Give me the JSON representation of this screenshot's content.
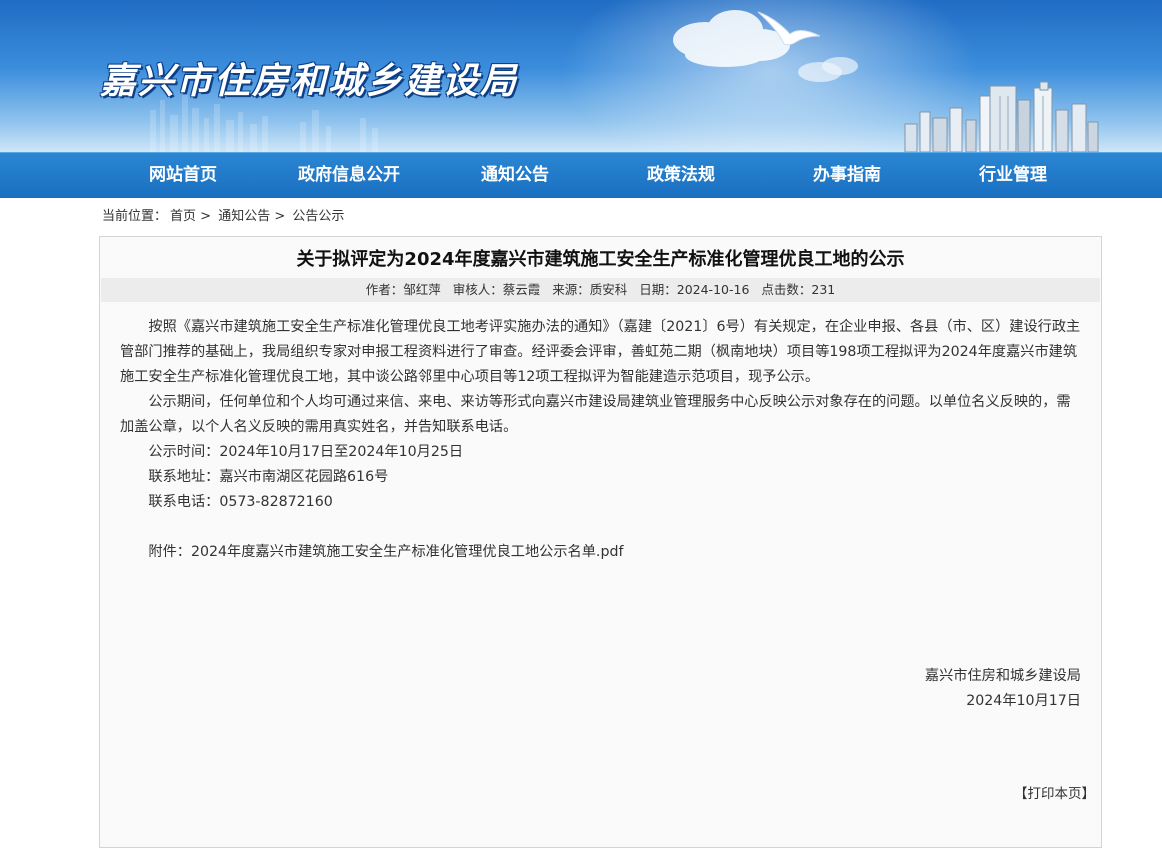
{
  "site": {
    "title": "嘉兴市住房和城乡建设局"
  },
  "nav": {
    "items": [
      {
        "label": "网站首页"
      },
      {
        "label": "政府信息公开"
      },
      {
        "label": "通知公告"
      },
      {
        "label": "政策法规"
      },
      {
        "label": "办事指南"
      },
      {
        "label": "行业管理"
      }
    ]
  },
  "breadcrumb": {
    "prefix": "当前位置：",
    "home": "首页",
    "level1": "通知公告",
    "level2": "公告公示",
    "sep": ">"
  },
  "article": {
    "title": "关于拟评定为2024年度嘉兴市建筑施工安全生产标准化管理优良工地的公示",
    "meta": {
      "author": "作者：邹红萍",
      "reviewer": "审核人：蔡云霞",
      "source": "来源：质安科",
      "date": "日期：2024-10-16",
      "hits": "点击数：231"
    },
    "paragraphs": [
      "按照《嘉兴市建筑施工安全生产标准化管理优良工地考评实施办法的通知》（嘉建〔2021〕6号）有关规定，在企业申报、各县（市、区）建设行政主管部门推荐的基础上，我局组织专家对申报工程资料进行了审查。经评委会评审，善虹苑二期（枫南地块）项目等198项工程拟评为2024年度嘉兴市建筑施工安全生产标准化管理优良工地，其中谈公路邻里中心项目等12项工程拟评为智能建造示范项目，现予公示。",
      "公示期间，任何单位和个人均可通过来信、来电、来访等形式向嘉兴市建设局建筑业管理服务中心反映公示对象存在的问题。以单位名义反映的，需加盖公章，以个人名义反映的需用真实姓名，并告知联系电话。",
      "公示时间：2024年10月17日至2024年10月25日",
      "联系地址：嘉兴市南湖区花园路616号",
      "联系电话：0573-82872160"
    ],
    "attachment": "附件：2024年度嘉兴市建筑施工安全生产标准化管理优良工地公示名单.pdf",
    "signature": {
      "org": "嘉兴市住房和城乡建设局",
      "date": "2024年10月17日"
    },
    "print_label": "【打印本页】"
  }
}
